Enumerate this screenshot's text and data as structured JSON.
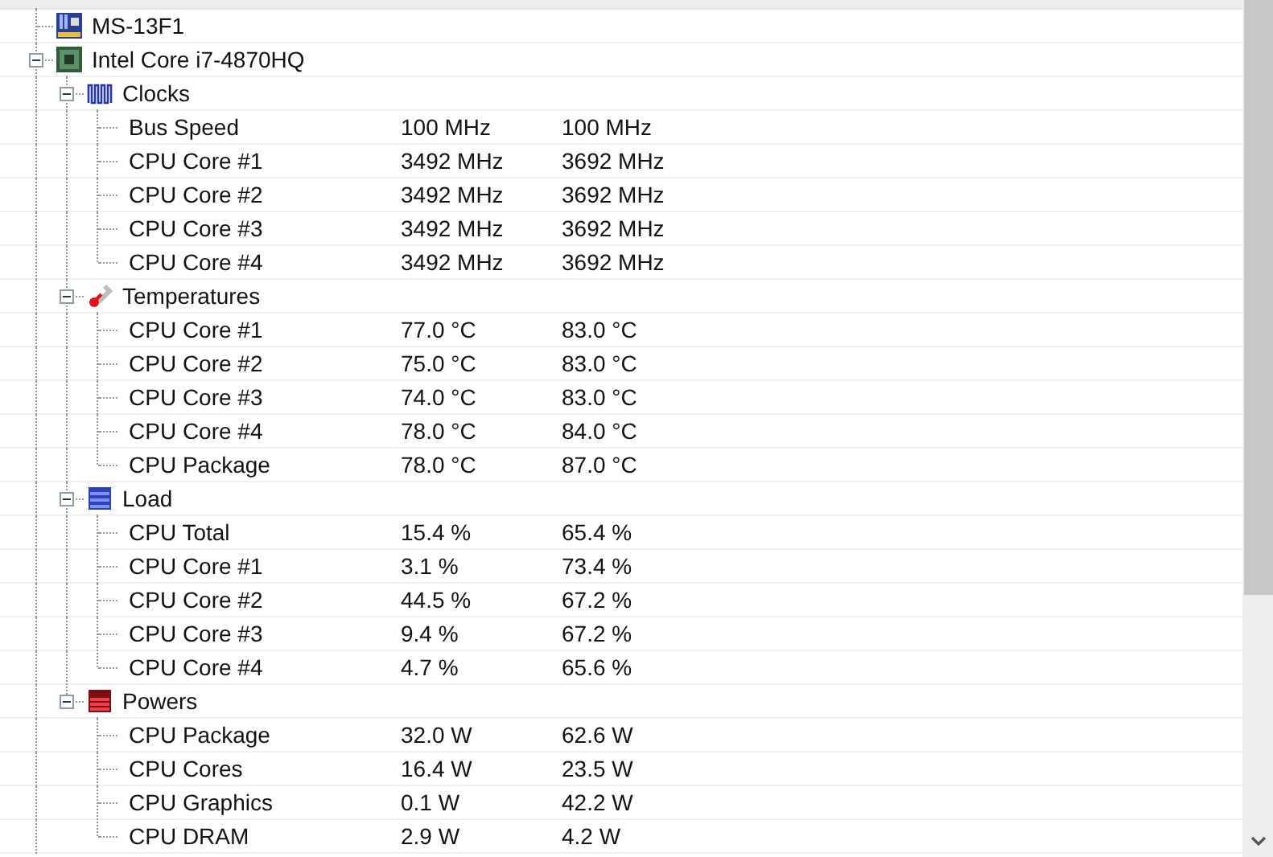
{
  "tree": [
    {
      "label": "MS-13F1",
      "kind": "mainboard"
    },
    {
      "label": "Intel Core i7-4870HQ",
      "kind": "cpu",
      "expanded": true,
      "children": [
        {
          "label": "Clocks",
          "kind": "clocks",
          "expanded": true,
          "children": [
            {
              "label": "Bus Speed",
              "kind": "sensor",
              "value": "100 MHz",
              "max": "100 MHz"
            },
            {
              "label": "CPU Core #1",
              "kind": "sensor",
              "value": "3492 MHz",
              "max": "3692 MHz"
            },
            {
              "label": "CPU Core #2",
              "kind": "sensor",
              "value": "3492 MHz",
              "max": "3692 MHz"
            },
            {
              "label": "CPU Core #3",
              "kind": "sensor",
              "value": "3492 MHz",
              "max": "3692 MHz"
            },
            {
              "label": "CPU Core #4",
              "kind": "sensor",
              "value": "3492 MHz",
              "max": "3692 MHz"
            }
          ]
        },
        {
          "label": "Temperatures",
          "kind": "temperatures",
          "expanded": true,
          "children": [
            {
              "label": "CPU Core #1",
              "kind": "sensor",
              "value": "77.0 °C",
              "max": "83.0 °C"
            },
            {
              "label": "CPU Core #2",
              "kind": "sensor",
              "value": "75.0 °C",
              "max": "83.0 °C"
            },
            {
              "label": "CPU Core #3",
              "kind": "sensor",
              "value": "74.0 °C",
              "max": "83.0 °C"
            },
            {
              "label": "CPU Core #4",
              "kind": "sensor",
              "value": "78.0 °C",
              "max": "84.0 °C"
            },
            {
              "label": "CPU Package",
              "kind": "sensor",
              "value": "78.0 °C",
              "max": "87.0 °C"
            }
          ]
        },
        {
          "label": "Load",
          "kind": "load",
          "expanded": true,
          "children": [
            {
              "label": "CPU Total",
              "kind": "sensor",
              "value": "15.4 %",
              "max": "65.4 %"
            },
            {
              "label": "CPU Core #1",
              "kind": "sensor",
              "value": "3.1 %",
              "max": "73.4 %"
            },
            {
              "label": "CPU Core #2",
              "kind": "sensor",
              "value": "44.5 %",
              "max": "67.2 %"
            },
            {
              "label": "CPU Core #3",
              "kind": "sensor",
              "value": "9.4 %",
              "max": "67.2 %"
            },
            {
              "label": "CPU Core #4",
              "kind": "sensor",
              "value": "4.7 %",
              "max": "65.6 %"
            }
          ]
        },
        {
          "label": "Powers",
          "kind": "powers",
          "expanded": true,
          "children": [
            {
              "label": "CPU Package",
              "kind": "sensor",
              "value": "32.0 W",
              "max": "62.6 W"
            },
            {
              "label": "CPU Cores",
              "kind": "sensor",
              "value": "16.4 W",
              "max": "23.5 W"
            },
            {
              "label": "CPU Graphics",
              "kind": "sensor",
              "value": "0.1 W",
              "max": "42.2 W"
            },
            {
              "label": "CPU DRAM",
              "kind": "sensor",
              "value": "2.9 W",
              "max": "4.2 W"
            }
          ]
        }
      ]
    }
  ]
}
